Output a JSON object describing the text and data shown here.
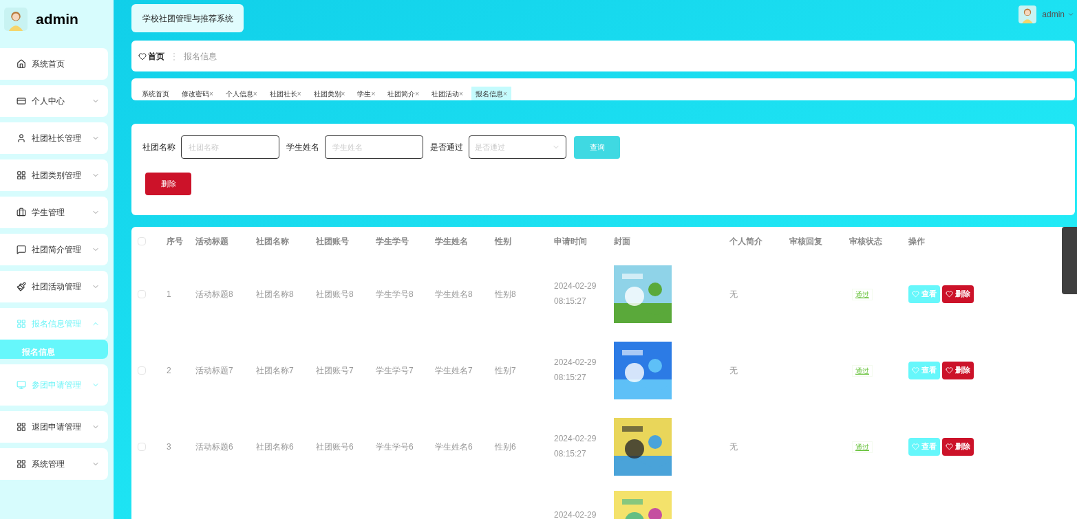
{
  "sidebar": {
    "user": "admin",
    "items": [
      {
        "label": "系统首页",
        "has_arrow": false,
        "highlighted": false
      },
      {
        "label": "个人中心",
        "has_arrow": true,
        "expanded": false,
        "highlighted": false
      },
      {
        "label": "社团社长管理",
        "has_arrow": true,
        "expanded": false,
        "highlighted": false
      },
      {
        "label": "社团类别管理",
        "has_arrow": true,
        "expanded": false,
        "highlighted": false
      },
      {
        "label": "学生管理",
        "has_arrow": true,
        "expanded": false,
        "highlighted": false
      },
      {
        "label": "社团简介管理",
        "has_arrow": true,
        "expanded": false,
        "highlighted": false
      },
      {
        "label": "社团活动管理",
        "has_arrow": true,
        "expanded": false,
        "highlighted": false
      },
      {
        "label": "报名信息管理",
        "has_arrow": true,
        "expanded": true,
        "highlighted": true,
        "children": [
          {
            "label": "报名信息",
            "selected": true
          }
        ]
      },
      {
        "label": "参团申请管理",
        "has_arrow": true,
        "expanded": false,
        "highlighted": true
      },
      {
        "label": "退团申请管理",
        "has_arrow": true,
        "expanded": false,
        "highlighted": false
      },
      {
        "label": "系统管理",
        "has_arrow": true,
        "expanded": false,
        "highlighted": false
      }
    ]
  },
  "header": {
    "title": "学校社团管理与推荐系统",
    "user": "admin"
  },
  "breadcrumb": {
    "home": "首页",
    "separator": "⋮",
    "current": "报名信息"
  },
  "tags": [
    {
      "label": "系统首页",
      "closable": false,
      "selected": false
    },
    {
      "label": "修改密码",
      "closable": true,
      "selected": false
    },
    {
      "label": "个人信息",
      "closable": true,
      "selected": false
    },
    {
      "label": "社团社长",
      "closable": true,
      "selected": false
    },
    {
      "label": "社团类别",
      "closable": true,
      "selected": false
    },
    {
      "label": "学生",
      "closable": true,
      "selected": false
    },
    {
      "label": "社团简介",
      "closable": true,
      "selected": false
    },
    {
      "label": "社团活动",
      "closable": true,
      "selected": false
    },
    {
      "label": "报名信息",
      "closable": true,
      "selected": true
    }
  ],
  "close_mark": "×",
  "search": {
    "fields": [
      {
        "kind": "input",
        "label": "社团名称",
        "placeholder": "社团名称"
      },
      {
        "kind": "input",
        "label": "学生姓名",
        "placeholder": "学生姓名"
      },
      {
        "kind": "select",
        "label": "是否通过",
        "placeholder": "是否通过"
      }
    ],
    "query_button": "查询",
    "delete_button": "删除"
  },
  "table": {
    "select_all_checked": false,
    "columns": [
      "序号",
      "活动标题",
      "社团名称",
      "社团账号",
      "学生学号",
      "学生姓名",
      "性别",
      "申请时间",
      "封面",
      "个人简介",
      "审核回复",
      "审核状态",
      "操作"
    ],
    "rows": [
      {
        "checked": false,
        "cells": [
          "1",
          "活动标题8",
          "社团名称8",
          "社团账号8",
          "学生学号8",
          "学生姓名8",
          "性别8"
        ],
        "time": [
          "2024-02-29",
          "08:15:27"
        ],
        "intro": "无",
        "status": "通过",
        "actions": [
          "查看",
          "删除"
        ]
      },
      {
        "checked": false,
        "cells": [
          "2",
          "活动标题7",
          "社团名称7",
          "社团账号7",
          "学生学号7",
          "学生姓名7",
          "性别7"
        ],
        "time": [
          "2024-02-29",
          "08:15:27"
        ],
        "intro": "无",
        "status": "通过",
        "actions": [
          "查看",
          "删除"
        ]
      },
      {
        "checked": false,
        "cells": [
          "3",
          "活动标题6",
          "社团名称6",
          "社团账号6",
          "学生学号6",
          "学生姓名6",
          "性别6"
        ],
        "time": [
          "2024-02-29",
          "08:15:27"
        ],
        "intro": "无",
        "status": "通过",
        "actions": [
          "查看",
          "删除"
        ]
      },
      {
        "cells": [],
        "time": [
          "2024-02-29"
        ],
        "actions": []
      }
    ]
  }
}
